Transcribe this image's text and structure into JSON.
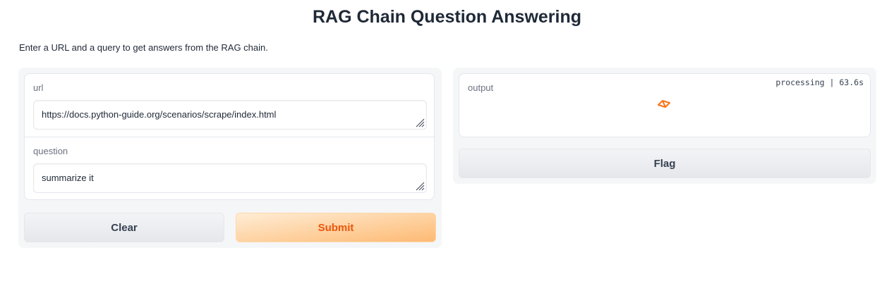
{
  "header": {
    "title": "RAG Chain Question Answering",
    "description": "Enter a URL and a query to get answers from the RAG chain."
  },
  "inputs": {
    "url": {
      "label": "url",
      "value": "https://docs.python-guide.org/scenarios/scrape/index.html"
    },
    "question": {
      "label": "question",
      "value": "summarize it"
    }
  },
  "buttons": {
    "clear_label": "Clear",
    "submit_label": "Submit",
    "flag_label": "Flag"
  },
  "output": {
    "label": "output",
    "status": "processing | 63.6s",
    "loader_icon": "loading-spinner-icon"
  },
  "colors": {
    "accent": "#ea580c",
    "submit_gradient_start": "#ffedd5",
    "submit_gradient_end": "#fdba74",
    "panel_background": "#f5f6f8"
  }
}
